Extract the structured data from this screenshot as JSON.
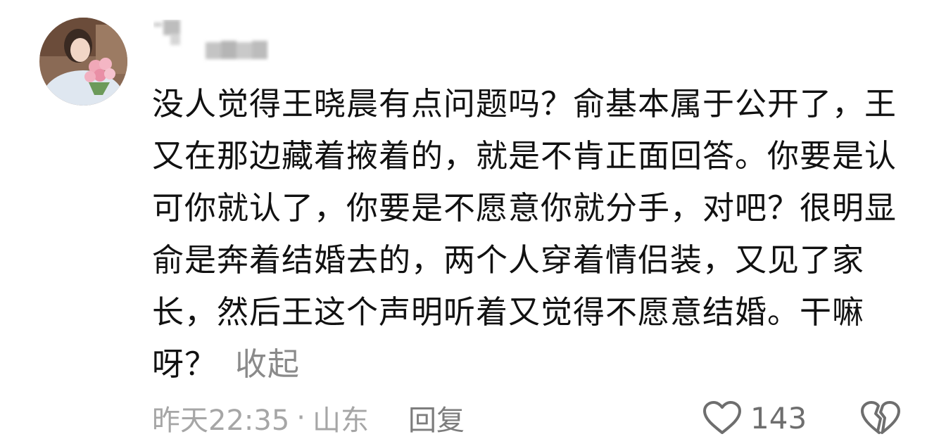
{
  "comment": {
    "avatar_icon": "user-avatar",
    "username_icon": "blurred-username",
    "text": "没人觉得王晓晨有点问题吗？俞基本属于公开了，王又在那边藏着掖着的，就是不肯正面回答。你要是认可你就认了，你要是不愿意你就分手，对吧？很明显俞是奔着结婚去的，两个人穿着情侣装，又见了家长，然后王这个声明听着又觉得不愿意结婚。干嘛呀？",
    "collapse_label": "收起",
    "timestamp": "昨天22:35",
    "separator": "·",
    "location": "山东",
    "reply_label": "回复",
    "like_icon": "heart-outline-icon",
    "like_count": "143",
    "dislike_icon": "broken-heart-icon"
  },
  "colors": {
    "text": "#111111",
    "meta": "#a6a6a6",
    "icon": "#6e6e6e",
    "background": "#ffffff"
  }
}
